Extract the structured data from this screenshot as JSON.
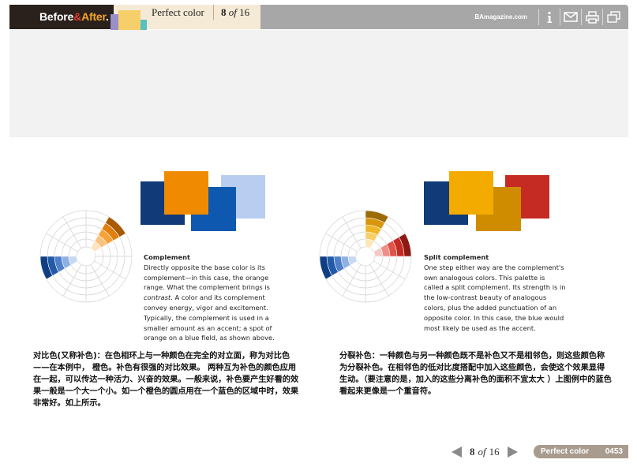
{
  "header": {
    "brand": {
      "before": "Before",
      "amp": "&",
      "after": "After",
      "dot": "."
    },
    "section_title": "Perfect color",
    "page": "8",
    "of": "of",
    "total": "16",
    "site": "BAmagazine.com",
    "icons": [
      "info-icon",
      "mail-icon",
      "print-icon",
      "window-icon"
    ]
  },
  "left": {
    "heading": "Complement",
    "body_1": "Directly opposite the base color is its complement—in this case, the orange range. What the complement brings is ",
    "body_em": "contrast",
    "body_2": ". A color and its complement convey energy, vigor and excitement. Typically, the complement is used in a smaller amount as an accent; a spot of orange on a blue field, as shown above.",
    "chinese": "对比色(又称补色)：在色相环上与一种颜色在完全的对立面，称为对比色——在本例中， 橙色。补色有很强的对比效果。 两种互为补色的颜色应用在一起，可以传达一种活力、兴奋的效果。一般来说，补色要产生好看的效果一般是一个大一个小。如一个橙色的圆点用在一个蓝色的区域中时，效果非常好。如上所示。"
  },
  "right": {
    "heading": "Split complement",
    "body": "One step either way are the complement's own analogous colors. This palette is called a split complement. Its strength is in the low-contrast beauty of analogous colors, plus the added punctuation of an opposite color. In this case, the blue would most likely be used as the accent.",
    "chinese": "分裂补色：一种颜色与另一种颜色既不是补色又不是相邻色，则这些颜色称为分裂补色。在相邻色的低对比度搭配中加入这些颜色，会使这个效果显得生动。（要注意的是，加入的这些分离补色的面积不宜太大 ）上图例中的蓝色看起来更像是一个重音符。"
  },
  "colors": {
    "navy": "#103a78",
    "blue": "#0f58b0",
    "light_blue": "#b8cdef",
    "orange": "#f08a00",
    "gold": "#f3ab00",
    "mustard": "#d08c00",
    "red": "#c52a23",
    "brand_bg": "#2a201c",
    "tag_bg": "#a89c8f"
  },
  "footer": {
    "page": "8",
    "of": "of",
    "total": "16",
    "section": "Perfect color",
    "folio": "0453"
  }
}
